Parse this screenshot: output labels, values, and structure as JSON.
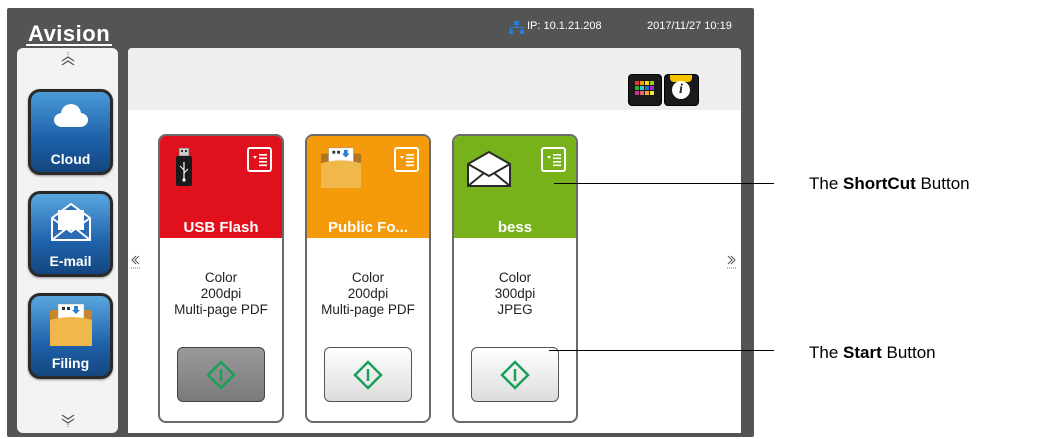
{
  "header": {
    "logo": "Avision",
    "ip": "IP: 10.1.21.208",
    "datetime": "2017/11/27 10:19"
  },
  "sidebar": {
    "items": [
      {
        "label": "Cloud",
        "icon": "cloud-icon"
      },
      {
        "label": "E-mail",
        "icon": "envelope-icon"
      },
      {
        "label": "Filing",
        "icon": "folder-icon"
      }
    ]
  },
  "toolbar": {
    "grid_icon": "color-grid-icon",
    "info_icon": "info-icon",
    "info_glyph": "i"
  },
  "cards": [
    {
      "title": "USB Flash",
      "color": "#e0101c",
      "icon": "usb-drive-icon",
      "line1": "Color",
      "line2": "200dpi",
      "line3": "Multi-page PDF",
      "pressed": true
    },
    {
      "title": "Public Fo...",
      "color": "#f59a0a",
      "icon": "folder-icon",
      "line1": "Color",
      "line2": "200dpi",
      "line3": "Multi-page PDF",
      "pressed": false
    },
    {
      "title": "bess",
      "color": "#78b21a",
      "icon": "envelope-icon",
      "line1": "Color",
      "line2": "300dpi",
      "line3": "JPEG",
      "pressed": false
    }
  ],
  "callouts": {
    "shortcut_pre": "The ",
    "shortcut_bold": "ShortCut",
    "shortcut_post": " Button",
    "start_pre": "The ",
    "start_bold": "Start",
    "start_post": " Button"
  },
  "colors": {
    "frame": "#545454",
    "start_green": "#1aa05a",
    "network_blue": "#2a7fd4"
  }
}
